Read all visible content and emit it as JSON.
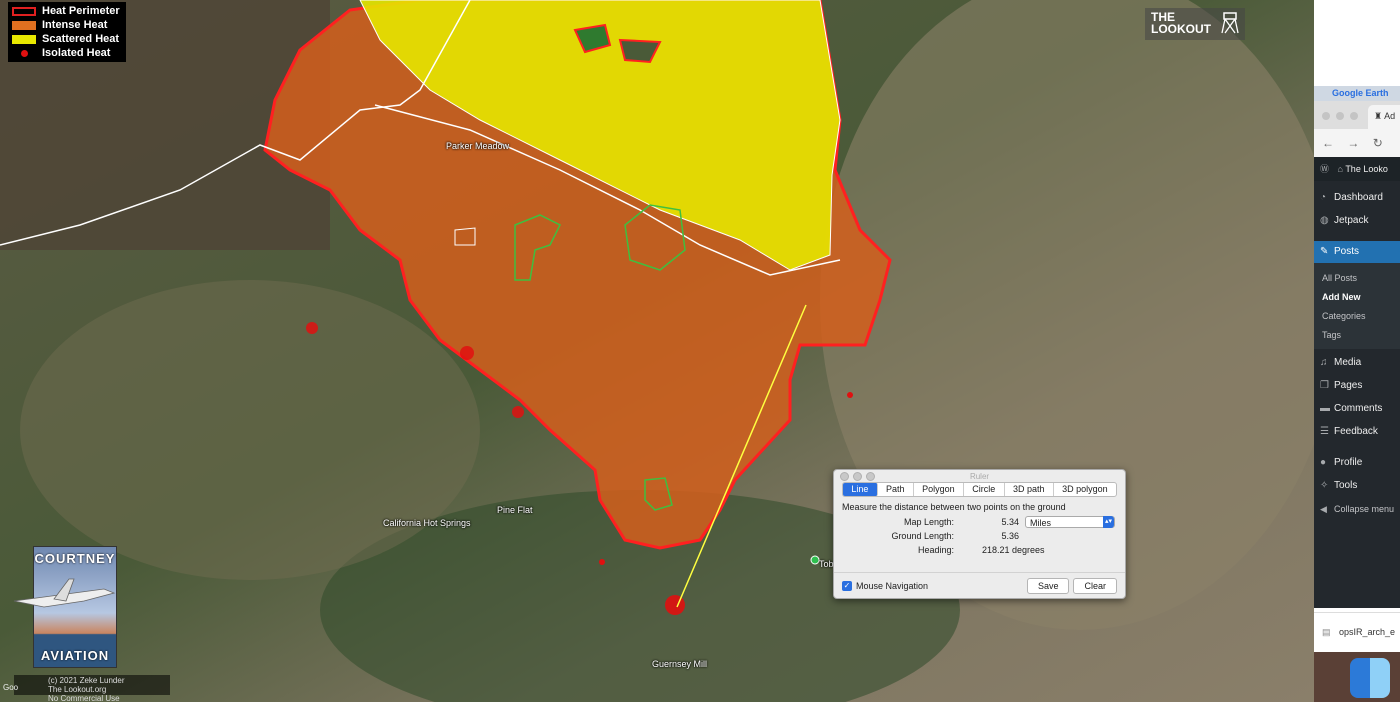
{
  "legend": {
    "items": [
      {
        "label": "Heat Perimeter",
        "type": "perimeter",
        "color": "#e02020"
      },
      {
        "label": "Intense Heat",
        "type": "fill",
        "color": "#e07020"
      },
      {
        "label": "Scattered Heat",
        "type": "fill",
        "color": "#e8e800"
      },
      {
        "label": "Isolated Heat",
        "type": "dot",
        "color": "#e01010"
      }
    ]
  },
  "places": [
    {
      "name": "Parker Meadow"
    },
    {
      "name": "Pine Flat"
    },
    {
      "name": "California Hot Springs"
    },
    {
      "name": "Guernsey Mill"
    },
    {
      "name": "Tob"
    }
  ],
  "logos": {
    "lookout": {
      "line1": "THE",
      "line2": "LOOKOUT"
    },
    "courtney": {
      "top": "COURTNEY",
      "bottom": "AVIATION"
    },
    "copyright": {
      "line1": "(c) 2021 Zeke Lunder",
      "line2": "The Lookout.org",
      "line3": "No Commercial Use"
    },
    "google": "Goo"
  },
  "ruler": {
    "title": "Ruler",
    "tabs": [
      "Line",
      "Path",
      "Polygon",
      "Circle",
      "3D path",
      "3D polygon"
    ],
    "active_tab": "Line",
    "description": "Measure the distance between two points on the ground",
    "map_length_label": "Map Length:",
    "map_length_value": "5.34",
    "unit": "Miles",
    "ground_length_label": "Ground Length:",
    "ground_length_value": "5.36",
    "heading_label": "Heading:",
    "heading_value": "218.21 degrees",
    "mouse_navigation_label": "Mouse Navigation",
    "mouse_navigation_checked": true,
    "save_label": "Save",
    "clear_label": "Clear"
  },
  "side": {
    "google_earth_tab": "Google Earth",
    "browser_tab": "Ad",
    "wp_site": "The Looko",
    "menu": {
      "dashboard": "Dashboard",
      "jetpack": "Jetpack",
      "posts": "Posts",
      "all_posts": "All Posts",
      "add_new": "Add New",
      "categories": "Categories",
      "tags": "Tags",
      "media": "Media",
      "pages": "Pages",
      "comments": "Comments",
      "feedback": "Feedback",
      "profile": "Profile",
      "tools": "Tools",
      "collapse": "Collapse menu"
    },
    "download_file": "opsIR_arch_e"
  }
}
